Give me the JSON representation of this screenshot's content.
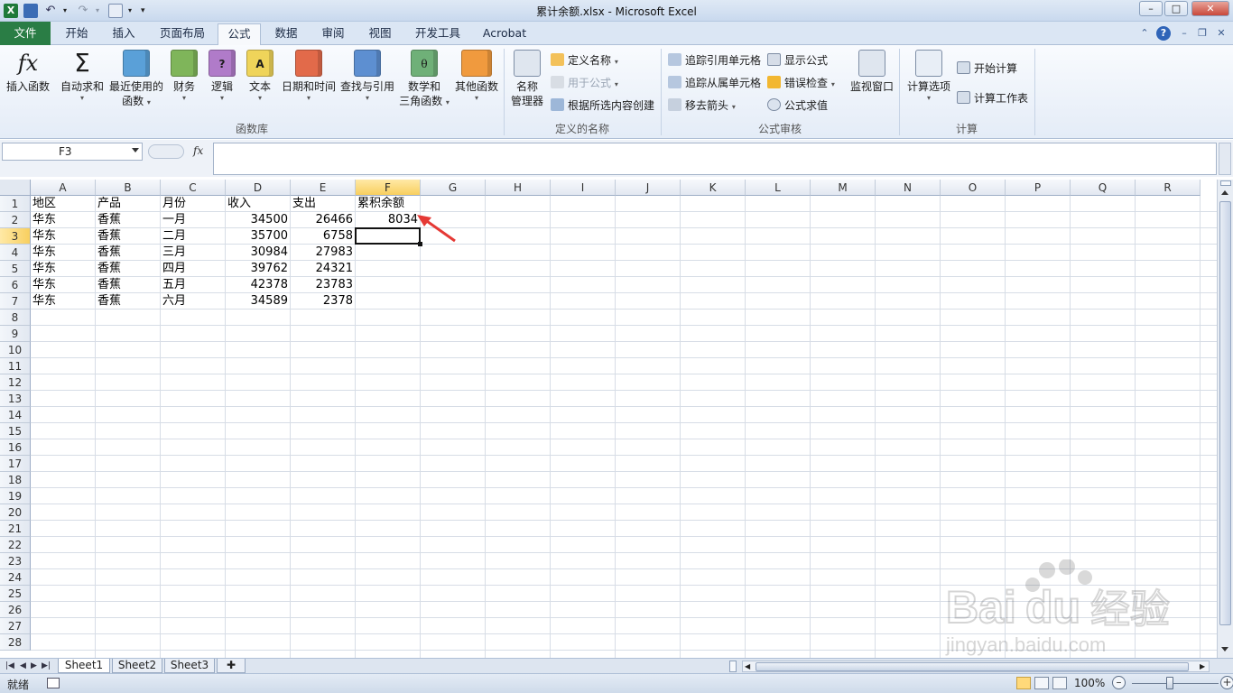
{
  "window": {
    "title": "累计余额.xlsx - Microsoft Excel"
  },
  "ribbon_tabs": [
    {
      "label": "文件"
    },
    {
      "label": "开始"
    },
    {
      "label": "插入"
    },
    {
      "label": "页面布局"
    },
    {
      "label": "公式"
    },
    {
      "label": "数据"
    },
    {
      "label": "审阅"
    },
    {
      "label": "视图"
    },
    {
      "label": "开发工具"
    },
    {
      "label": "Acrobat"
    }
  ],
  "ribbon": {
    "function_library": {
      "group_label": "函数库",
      "insert_function": "插入函数",
      "autosum": "自动求和",
      "recent_1": "最近使用的",
      "recent_2": "函数",
      "financial": "财务",
      "logical": "逻辑",
      "text": "文本",
      "datetime": "日期和时间",
      "lookup": "查找与引用",
      "math_1": "数学和",
      "math_2": "三角函数",
      "more": "其他函数"
    },
    "defined_names": {
      "group_label": "定义的名称",
      "name_manager_1": "名称",
      "name_manager_2": "管理器",
      "define_name": "定义名称",
      "use_in_formula": "用于公式",
      "create_from_selection": "根据所选内容创建"
    },
    "formula_auditing": {
      "group_label": "公式审核",
      "trace_precedents": "追踪引用单元格",
      "trace_dependents": "追踪从属单元格",
      "remove_arrows": "移去箭头",
      "show_formulas": "显示公式",
      "error_checking": "错误检查",
      "evaluate_formula": "公式求值",
      "watch_window": "监视窗口"
    },
    "calculation": {
      "group_label": "计算",
      "options": "计算选项",
      "calc_now": "开始计算",
      "calc_sheet": "计算工作表"
    }
  },
  "formula_bar": {
    "name_box": "F3",
    "fx_label": "fx",
    "content": ""
  },
  "columns": [
    "A",
    "B",
    "C",
    "D",
    "E",
    "F",
    "G",
    "H",
    "I",
    "J",
    "K",
    "L",
    "M",
    "N",
    "O",
    "P",
    "Q",
    "R"
  ],
  "rows": [
    "1",
    "2",
    "3",
    "4",
    "5",
    "6",
    "7",
    "8",
    "9",
    "10",
    "11",
    "12",
    "13",
    "14",
    "15",
    "16",
    "17",
    "18",
    "19",
    "20",
    "21",
    "22",
    "23",
    "24",
    "25",
    "26",
    "27",
    "28"
  ],
  "selected": {
    "column": "F",
    "row": "3"
  },
  "cells": {
    "A1": "地区",
    "B1": "产品",
    "C1": "月份",
    "D1": "收入",
    "E1": "支出",
    "F1": "累积余额",
    "A2": "华东",
    "B2": "香蕉",
    "C2": "一月",
    "D2": "34500",
    "E2": "26466",
    "F2": "8034",
    "A3": "华东",
    "B3": "香蕉",
    "C3": "二月",
    "D3": "35700",
    "E3": "6758",
    "A4": "华东",
    "B4": "香蕉",
    "C4": "三月",
    "D4": "30984",
    "E4": "27983",
    "A5": "华东",
    "B5": "香蕉",
    "C5": "四月",
    "D5": "39762",
    "E5": "24321",
    "A6": "华东",
    "B6": "香蕉",
    "C6": "五月",
    "D6": "42378",
    "E6": "23783",
    "A7": "华东",
    "B7": "香蕉",
    "C7": "六月",
    "D7": "34589",
    "E7": "2378"
  },
  "numeric_columns": [
    "D",
    "E",
    "F"
  ],
  "sheets": [
    {
      "label": "Sheet1"
    },
    {
      "label": "Sheet2"
    },
    {
      "label": "Sheet3"
    }
  ],
  "status": {
    "ready": "就绪",
    "zoom": "100%"
  },
  "watermark": {
    "brand": "Bai",
    "brand2": "du",
    "cn": "经验",
    "url": "jingyan.baidu.com"
  },
  "colors": {
    "file_tab": "#2a7d45",
    "selected_header": "#f8cf5f",
    "annotation_arrow": "#e53935"
  }
}
